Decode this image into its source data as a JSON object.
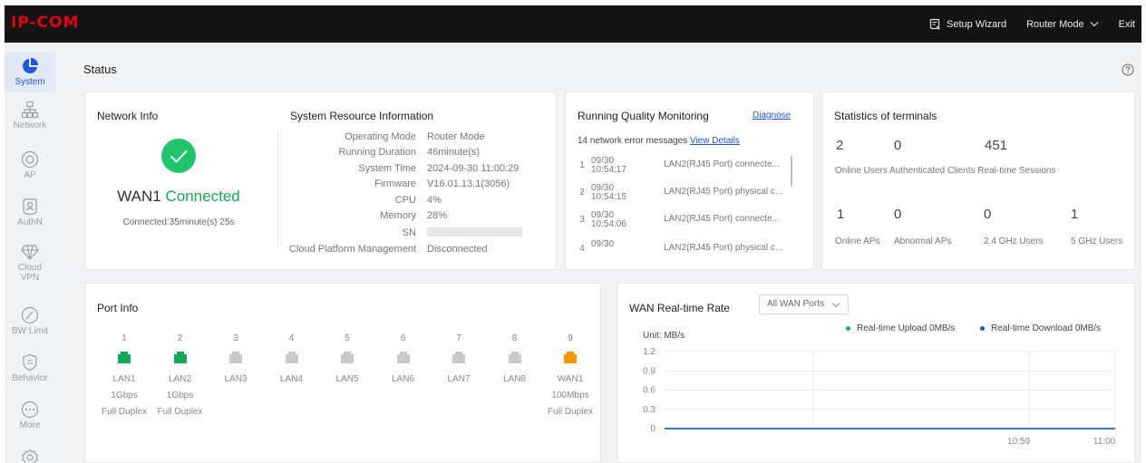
{
  "header": {
    "logo": "IP-COM",
    "setup_wizard": "Setup Wizard",
    "router_mode": "Router Mode",
    "exit": "Exit"
  },
  "sidebar": {
    "items": [
      {
        "label": "System",
        "icon": "pie-chart-icon"
      },
      {
        "label": "Network",
        "icon": "network-icon"
      },
      {
        "label": "AP",
        "icon": "ap-icon"
      },
      {
        "label": "AuthN",
        "icon": "auth-icon"
      },
      {
        "label": "Cloud",
        "label2": "VPN",
        "icon": "cloud-vpn-icon"
      },
      {
        "label": "BW Limit",
        "icon": "gauge-icon"
      },
      {
        "label": "Behavior",
        "icon": "shield-icon"
      },
      {
        "label": "More",
        "icon": "more-icon"
      }
    ]
  },
  "page": {
    "title": "Status"
  },
  "network_info": {
    "title": "Network Info",
    "wan_label": "WAN1",
    "status": "Connected",
    "duration": "Connected:35minute(s) 25s"
  },
  "system_resource": {
    "title": "System Resource Information",
    "rows": [
      {
        "key": "Operating Mode",
        "value": "Router Mode"
      },
      {
        "key": "Running Duration",
        "value": "46minute(s)"
      },
      {
        "key": "System Time",
        "value": "2024-09-30 11:00:29"
      },
      {
        "key": "Firmware",
        "value": "V16.01.13.1(3056)"
      },
      {
        "key": "CPU",
        "value": "4%"
      },
      {
        "key": "Memory",
        "value": "28%"
      },
      {
        "key": "SN",
        "value": ""
      },
      {
        "key": "Cloud Platform Management",
        "value": "Disconnected"
      }
    ]
  },
  "running_quality": {
    "title": "Running Quality Monitoring",
    "diagnose": "Diagnose",
    "summary": "14 network error messages",
    "view_details": "View Details",
    "entries": [
      {
        "num": "1",
        "date": "09/30",
        "time": "10:54:17",
        "msg": "LAN2(RJ45 Port) connecte..."
      },
      {
        "num": "2",
        "date": "09/30",
        "time": "10:54:15",
        "msg": "LAN2(RJ45 Port) physical c..."
      },
      {
        "num": "3",
        "date": "09/30",
        "time": "10:54:06",
        "msg": "LAN2(RJ45 Port) connecte..."
      },
      {
        "num": "4",
        "date": "09/30",
        "time": "",
        "msg": "LAN2(RJ45 Port) physical c..."
      }
    ]
  },
  "terminals": {
    "title": "Statistics of terminals",
    "online_users": "2",
    "auth_clients": "0",
    "sessions": "451",
    "row1_label": "Online Users Authenticated Clients Real-time Sessions",
    "online_aps": "1",
    "abnormal_aps": "0",
    "users_24": "0",
    "users_5": "1",
    "online_aps_label": "Online APs",
    "abnormal_aps_label": "Abnormal APs",
    "users_24_label": "2.4 GHz Users",
    "users_5_label": "5 GHz Users"
  },
  "port_info": {
    "title": "Port Info",
    "ports": [
      {
        "num": "1",
        "name": "LAN1",
        "speed": "1Gbps",
        "duplex": "Full Duplex",
        "state": "lan-up",
        "color": "#12a85c"
      },
      {
        "num": "2",
        "name": "LAN2",
        "speed": "1Gbps",
        "duplex": "Full Duplex",
        "state": "lan-up",
        "color": "#12a85c"
      },
      {
        "num": "3",
        "name": "LAN3",
        "speed": "",
        "duplex": "",
        "state": "down",
        "color": "#c8c9cc"
      },
      {
        "num": "4",
        "name": "LAN4",
        "speed": "",
        "duplex": "",
        "state": "down",
        "color": "#c8c9cc"
      },
      {
        "num": "5",
        "name": "LAN5",
        "speed": "",
        "duplex": "",
        "state": "down",
        "color": "#c8c9cc"
      },
      {
        "num": "6",
        "name": "LAN6",
        "speed": "",
        "duplex": "",
        "state": "down",
        "color": "#c8c9cc"
      },
      {
        "num": "7",
        "name": "LAN7",
        "speed": "",
        "duplex": "",
        "state": "down",
        "color": "#c8c9cc"
      },
      {
        "num": "8",
        "name": "LAN8",
        "speed": "",
        "duplex": "",
        "state": "down",
        "color": "#c8c9cc"
      },
      {
        "num": "9",
        "name": "WAN1",
        "speed": "100Mbps",
        "duplex": "Full Duplex",
        "state": "wan-up",
        "color": "#f39800"
      }
    ]
  },
  "wan_rate": {
    "title": "WAN Real-time Rate",
    "select": "All WAN Ports",
    "unit": "Unit: MB/s",
    "upload_legend": "Real-time Upload 0MB/s",
    "download_legend": "Real-time Download 0MB/s",
    "upload_color": "#17b26a",
    "download_color": "#1e57d8"
  },
  "chart_data": {
    "type": "line",
    "ylabel": "Unit: MB/s",
    "ylim": [
      0,
      1.2
    ],
    "yticks": [
      "1.2",
      "0.9",
      "0.6",
      "0.3",
      "0"
    ],
    "xticks": [
      "10:59",
      "11:00"
    ],
    "grid": true,
    "legend": "top-right",
    "series": [
      {
        "name": "Real-time Upload 0MB/s",
        "values": [
          0,
          0,
          0,
          0,
          0,
          0
        ],
        "color": "#17b26a"
      },
      {
        "name": "Real-time Download 0MB/s",
        "values": [
          0,
          0,
          0,
          0,
          0,
          0
        ],
        "color": "#1e57d8"
      }
    ]
  }
}
